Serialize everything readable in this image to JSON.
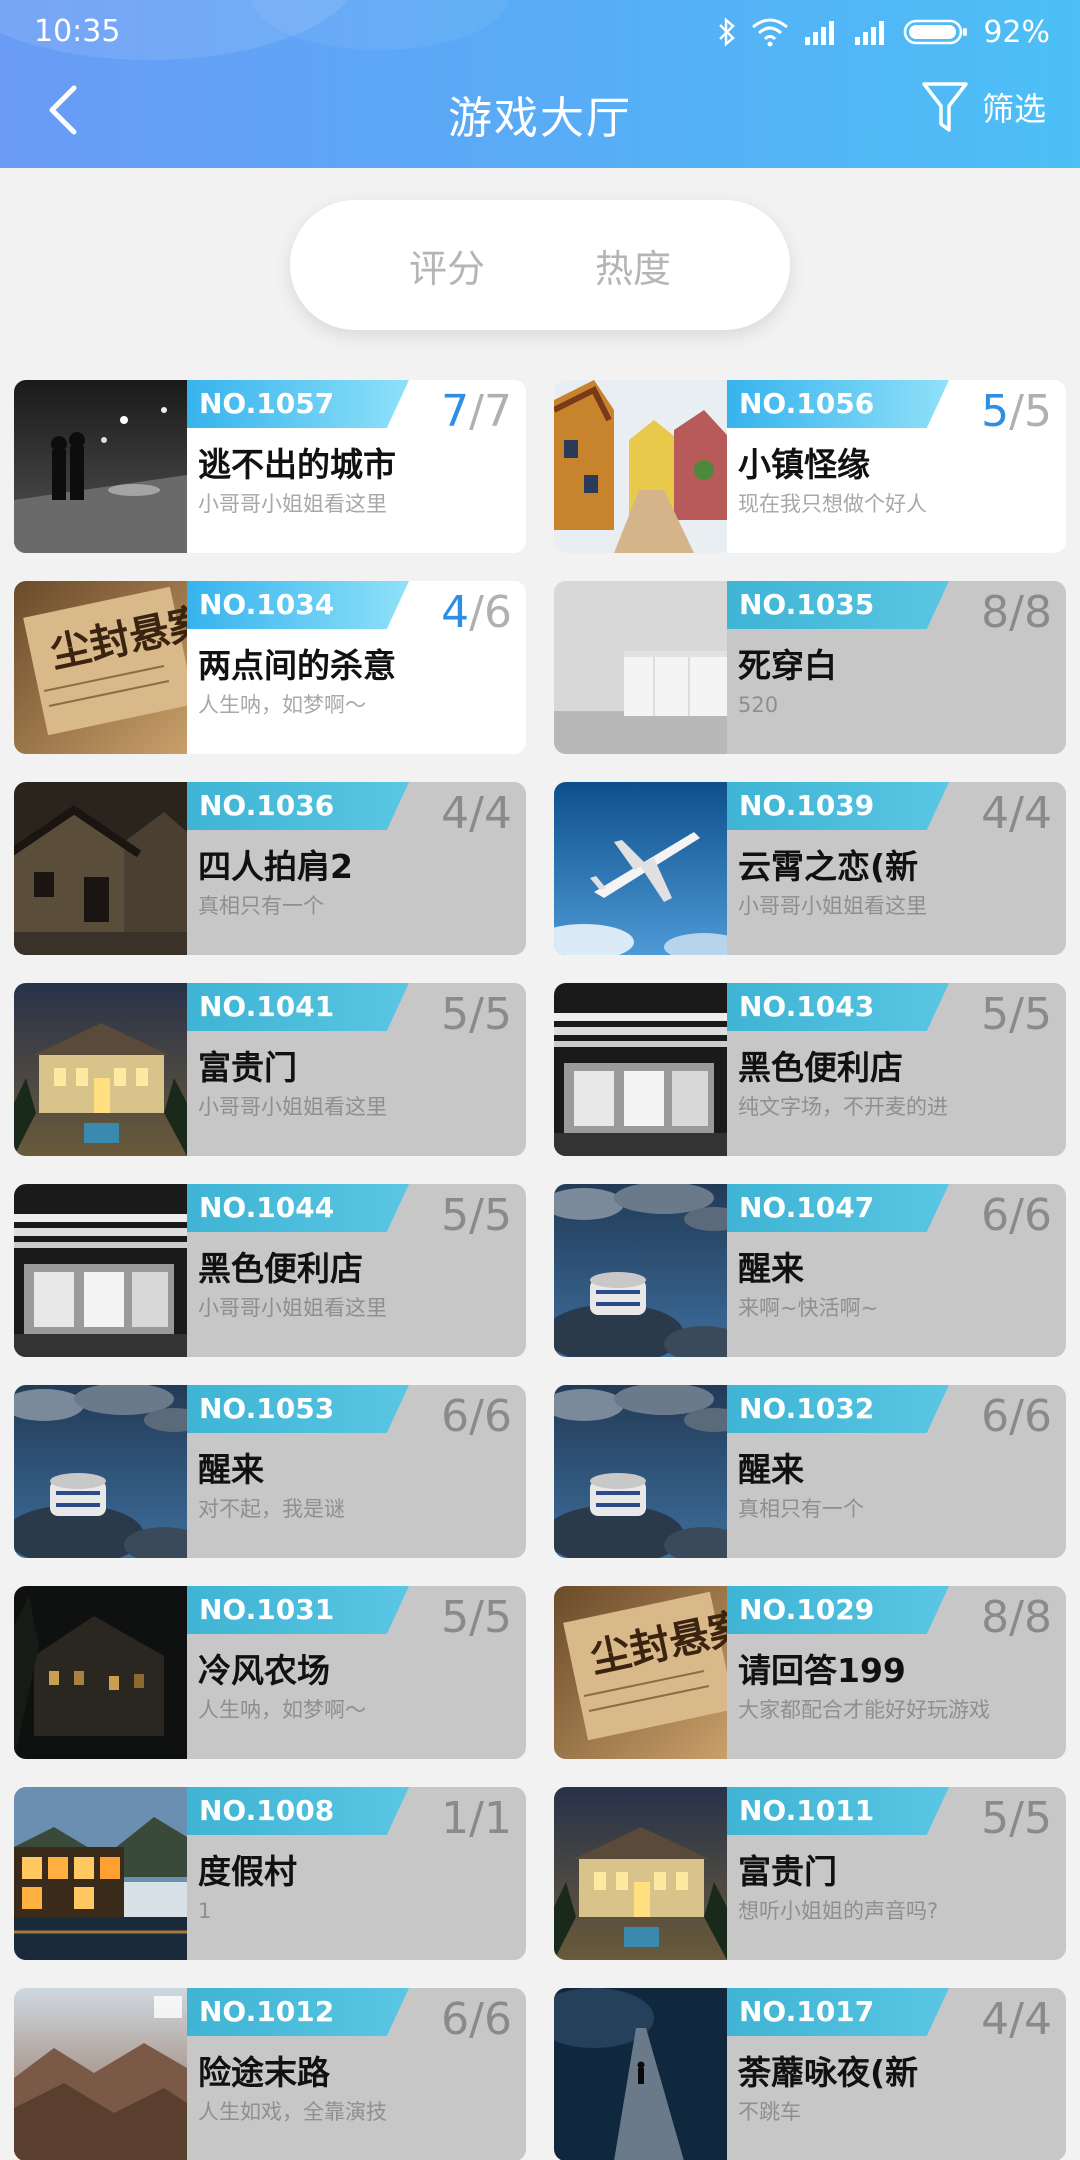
{
  "status": {
    "time": "10:35",
    "battery": "92%"
  },
  "header": {
    "title": "游戏大厅",
    "filter_label": "筛选"
  },
  "sort": {
    "tabs": [
      "评分",
      "热度"
    ]
  },
  "colors": {
    "header_start": "#6a9bf5",
    "header_end": "#4cbff6",
    "accent": "#2e8ee6",
    "tag": "#3fb4d4"
  },
  "games": [
    {
      "no": "NO.1057",
      "title": "逃不出的城市",
      "subtitle": "小哥哥小姐姐看这里",
      "current": "7",
      "total": "/7",
      "active": true,
      "thumb": "night-street"
    },
    {
      "no": "NO.1056",
      "title": "小镇怪缘",
      "subtitle": "现在我只想做个好人",
      "current": "5",
      "total": "/5",
      "active": true,
      "thumb": "painted-village"
    },
    {
      "no": "NO.1034",
      "title": "两点间的杀意",
      "subtitle": "人生呐，如梦啊～",
      "current": "4",
      "total": "/6",
      "active": true,
      "thumb": "newspaper"
    },
    {
      "no": "NO.1035",
      "title": "死穿白",
      "subtitle": "520",
      "current": "8",
      "total": "/8",
      "active": false,
      "thumb": "white-room"
    },
    {
      "no": "NO.1036",
      "title": "四人拍肩2",
      "subtitle": "真相只有一个",
      "current": "4",
      "total": "/4",
      "active": false,
      "thumb": "old-house"
    },
    {
      "no": "NO.1039",
      "title": "云霄之恋(新",
      "subtitle": "小哥哥小姐姐看这里",
      "current": "4",
      "total": "/4",
      "active": false,
      "thumb": "airplane"
    },
    {
      "no": "NO.1041",
      "title": "富贵门",
      "subtitle": "小哥哥小姐姐看这里",
      "current": "5",
      "total": "/5",
      "active": false,
      "thumb": "mansion"
    },
    {
      "no": "NO.1043",
      "title": "黑色便利店",
      "subtitle": "纯文字场，不开麦的进",
      "current": "5",
      "total": "/5",
      "active": false,
      "thumb": "store"
    },
    {
      "no": "NO.1044",
      "title": "黑色便利店",
      "subtitle": "小哥哥小姐姐看这里",
      "current": "5",
      "total": "/5",
      "active": false,
      "thumb": "store"
    },
    {
      "no": "NO.1047",
      "title": "醒来",
      "subtitle": "来啊~快活啊~",
      "current": "6",
      "total": "/6",
      "active": false,
      "thumb": "water-rocks"
    },
    {
      "no": "NO.1053",
      "title": "醒来",
      "subtitle": "对不起，我是谜",
      "current": "6",
      "total": "/6",
      "active": false,
      "thumb": "water-rocks"
    },
    {
      "no": "NO.1032",
      "title": "醒来",
      "subtitle": "真相只有一个",
      "current": "6",
      "total": "/6",
      "active": false,
      "thumb": "water-rocks"
    },
    {
      "no": "NO.1031",
      "title": "冷风农场",
      "subtitle": "人生呐，如梦啊～",
      "current": "5",
      "total": "/5",
      "active": false,
      "thumb": "dark-house"
    },
    {
      "no": "NO.1029",
      "title": "请回答199",
      "subtitle": "大家都配合才能好好玩游戏",
      "current": "8",
      "total": "/8",
      "active": false,
      "thumb": "newspaper"
    },
    {
      "no": "NO.1008",
      "title": "度假村",
      "subtitle": "1",
      "current": "1",
      "total": "/1",
      "active": false,
      "thumb": "resort"
    },
    {
      "no": "NO.1011",
      "title": "富贵门",
      "subtitle": "想听小姐姐的声音吗?",
      "current": "5",
      "total": "/5",
      "active": false,
      "thumb": "mansion"
    },
    {
      "no": "NO.1012",
      "title": "险途末路",
      "subtitle": "人生如戏，全靠演技",
      "current": "6",
      "total": "/6",
      "active": false,
      "thumb": "mountains"
    },
    {
      "no": "NO.1017",
      "title": "荼蘼咏夜(新",
      "subtitle": "不跳车",
      "current": "4",
      "total": "/4",
      "active": false,
      "thumb": "lonely-road"
    }
  ]
}
